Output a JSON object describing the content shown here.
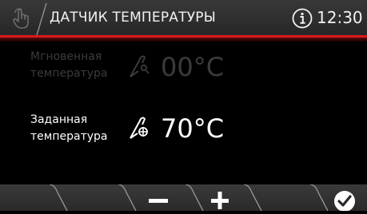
{
  "header": {
    "title": "ДАТЧИК ТЕМПЕРАТУРЫ",
    "time": "12:30",
    "accent_color": "#d9191c",
    "icons": [
      "hand-touch-icon",
      "info-icon"
    ]
  },
  "rows": {
    "instant": {
      "label_line1": "Мгновенная",
      "label_line2": "температура",
      "value": "00°C",
      "icon": "probe-thermometer-icon",
      "state": "dimmed"
    },
    "set": {
      "label_line1": "Заданная",
      "label_line2": "температура",
      "value": "70°C",
      "icon": "probe-target-icon",
      "state": "active"
    }
  },
  "bottom_bar": {
    "buttons": [
      "minus-icon",
      "plus-icon",
      "checkmark-icon"
    ]
  }
}
